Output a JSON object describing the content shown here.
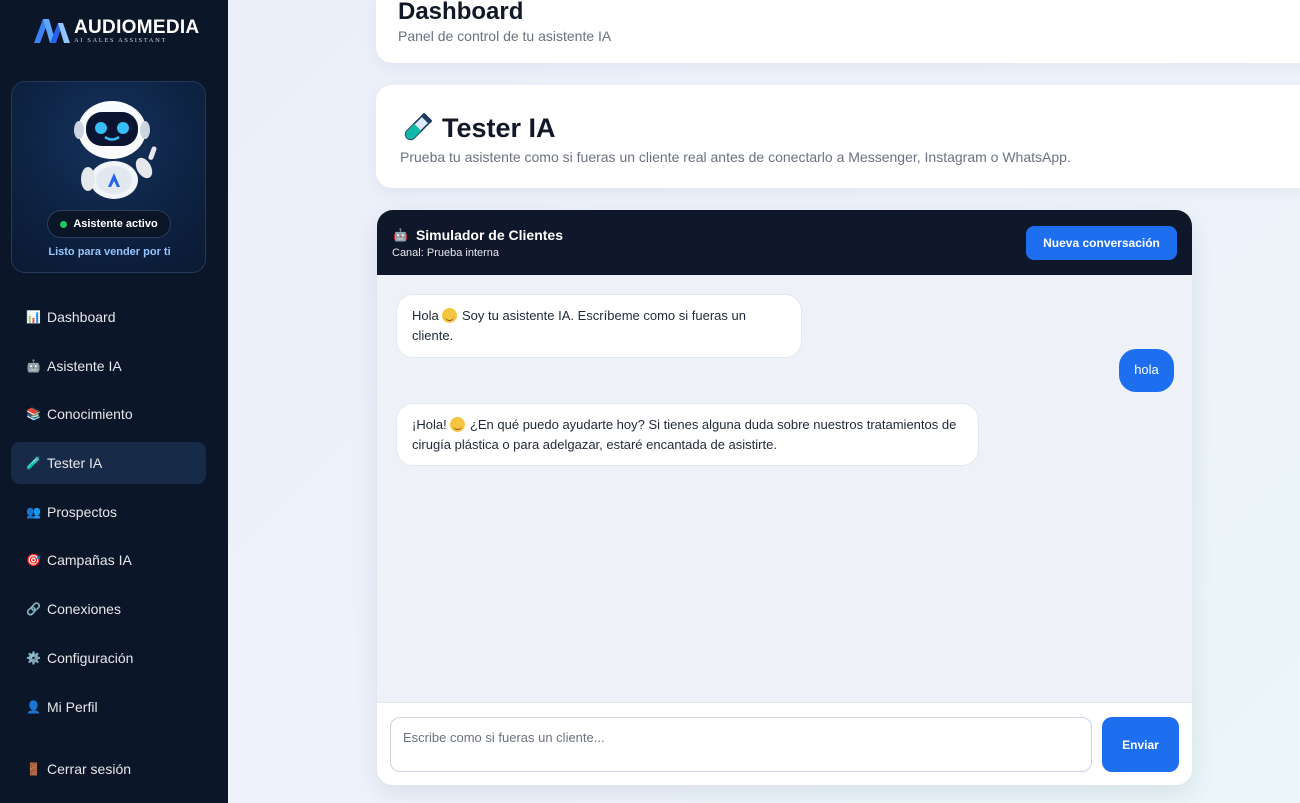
{
  "brand": {
    "name": "AUDIOMEDIA",
    "tagline": "AI SALES ASSISTANT"
  },
  "assistant_card": {
    "status": "Asistente activo",
    "caption": "Listo para vender por ti"
  },
  "sidebar": {
    "items": [
      {
        "icon": "bar-chart-icon",
        "glyph": "📊",
        "label": "Dashboard"
      },
      {
        "icon": "robot-icon",
        "glyph": "🤖",
        "label": "Asistente IA"
      },
      {
        "icon": "books-icon",
        "glyph": "📚",
        "label": "Conocimiento"
      },
      {
        "icon": "test-tube-icon",
        "glyph": "🧪",
        "label": "Tester IA"
      },
      {
        "icon": "people-icon",
        "glyph": "👥",
        "label": "Prospectos"
      },
      {
        "icon": "target-icon",
        "glyph": "🎯",
        "label": "Campañas IA"
      },
      {
        "icon": "link-icon",
        "glyph": "🔗",
        "label": "Conexiones"
      },
      {
        "icon": "gear-icon",
        "glyph": "⚙️",
        "label": "Configuración"
      },
      {
        "icon": "user-icon",
        "glyph": "👤",
        "label": "Mi Perfil"
      }
    ],
    "active_index": 3,
    "logout": {
      "icon": "door-icon",
      "glyph": "🚪",
      "label": "Cerrar sesión"
    }
  },
  "header": {
    "title": "Dashboard",
    "subtitle": "Panel de control de tu asistente IA"
  },
  "tester": {
    "title": "Tester IA",
    "description": "Prueba tu asistente como si fueras un cliente real antes de conectarlo a Messenger, Instagram o WhatsApp."
  },
  "simulator": {
    "title": "Simulador de Clientes",
    "title_glyph": "🤖",
    "channel": "Canal: Prueba interna",
    "new_conversation": "Nueva conversación",
    "messages": [
      {
        "role": "bot",
        "before": "Hola",
        "after": "Soy tu asistente IA. Escríbeme como si fueras un cliente."
      },
      {
        "role": "user",
        "text": "hola"
      },
      {
        "role": "bot",
        "before": "¡Hola!",
        "after": "¿En qué puedo ayudarte hoy? Si tienes alguna duda sobre nuestros tratamientos de cirugía plástica o para adelgazar, estaré encantada de asistirte."
      }
    ],
    "input_placeholder": "Escribe como si fueras un cliente...",
    "send_label": "Enviar"
  },
  "colors": {
    "sidebar_bg": "#0b1628",
    "accent": "#1d6ff0",
    "chat_header": "#0f172a",
    "status_green": "#22c55e"
  }
}
